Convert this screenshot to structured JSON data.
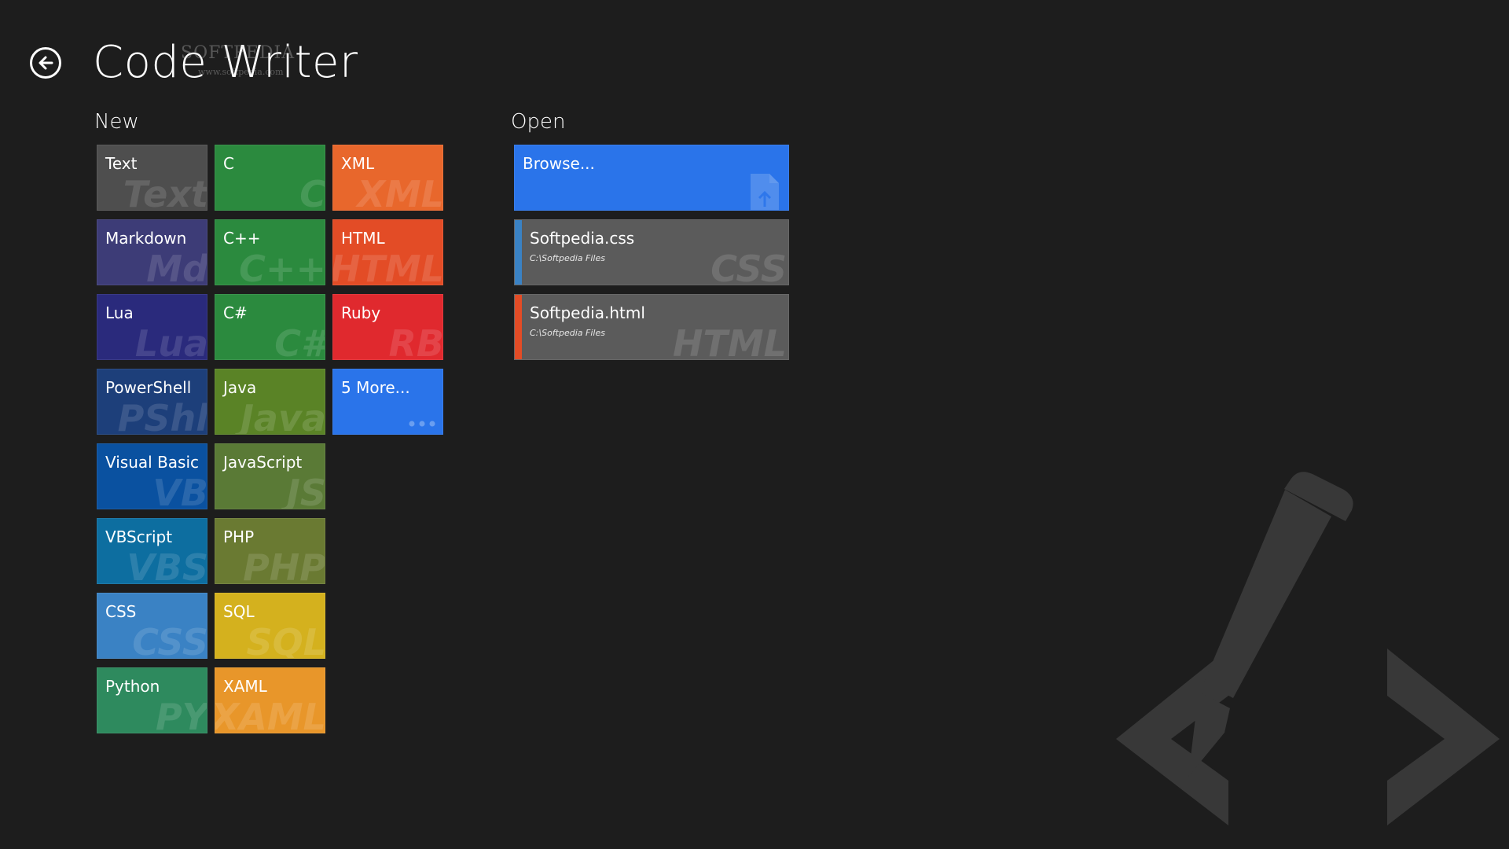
{
  "header": {
    "title": "Code Writer",
    "watermark": "SOFTPEDIA",
    "watermark_url": "www.softpedia.com"
  },
  "new_section": {
    "heading": "New",
    "tiles": [
      {
        "label": "Text",
        "ghost": "Text",
        "color": "#4e4e4e"
      },
      {
        "label": "C",
        "ghost": "C",
        "color": "#2b8a3e"
      },
      {
        "label": "XML",
        "ghost": "XML",
        "color": "#e8672c"
      },
      {
        "label": "Markdown",
        "ghost": "Md",
        "color": "#3d3c77"
      },
      {
        "label": "C++",
        "ghost": "C++",
        "color": "#2b8a3e"
      },
      {
        "label": "HTML",
        "ghost": "HTML",
        "color": "#e34c26"
      },
      {
        "label": "Lua",
        "ghost": "Lua",
        "color": "#2a2a7c"
      },
      {
        "label": "C#",
        "ghost": "C#",
        "color": "#2b8a3e"
      },
      {
        "label": "Ruby",
        "ghost": "RB",
        "color": "#e0292e"
      },
      {
        "label": "PowerShell",
        "ghost": "PShl",
        "color": "#1d3f7a"
      },
      {
        "label": "Java",
        "ghost": "Java",
        "color": "#5a8326"
      },
      {
        "label": "5 More...",
        "ghost": "",
        "color": "#2a74ea"
      },
      {
        "label": "Visual Basic",
        "ghost": "VB",
        "color": "#0a51a0"
      },
      {
        "label": "JavaScript",
        "ghost": "JS",
        "color": "#5a7a36"
      },
      {
        "label": "VBScript",
        "ghost": "VBS",
        "color": "#0d6ea0"
      },
      {
        "label": "PHP",
        "ghost": "PHP",
        "color": "#6a7a32"
      },
      {
        "label": "CSS",
        "ghost": "CSS",
        "color": "#3a82c4"
      },
      {
        "label": "SQL",
        "ghost": "SQL",
        "color": "#d4b11e"
      },
      {
        "label": "Python",
        "ghost": "PY",
        "color": "#2e8a5e"
      },
      {
        "label": "XAML",
        "ghost": "XAML",
        "color": "#e8962a"
      }
    ]
  },
  "open_section": {
    "heading": "Open",
    "browse": {
      "label": "Browse...",
      "icon": "file-upload-icon",
      "color": "#2a74ea"
    },
    "recent": [
      {
        "name": "Softpedia.css",
        "path": "C:\\Softpedia Files",
        "ghost": "CSS",
        "accent": "#3a82c4"
      },
      {
        "name": "Softpedia.html",
        "path": "C:\\Softpedia Files",
        "ghost": "HTML",
        "accent": "#e34c26"
      }
    ]
  },
  "icons": {
    "back": "back-arrow-icon",
    "more": "more-dots-icon",
    "background": "pencil-code-logo-icon"
  }
}
